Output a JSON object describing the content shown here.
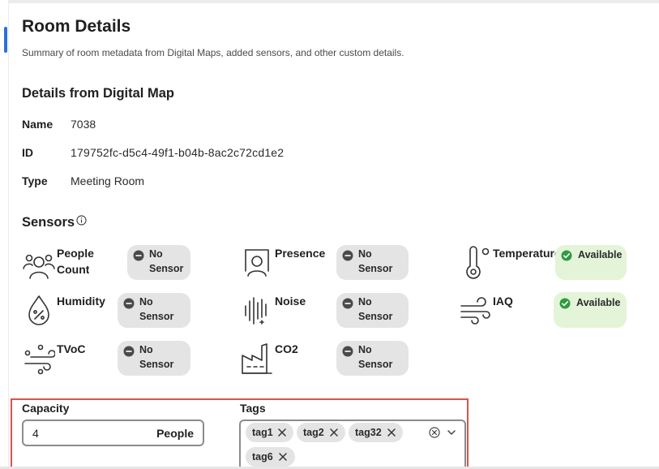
{
  "header": {
    "title": "Room Details",
    "subtitle": "Summary of room metadata from Digital Maps, added sensors, and other custom details."
  },
  "digital_map": {
    "heading": "Details from Digital Map",
    "fields": [
      {
        "label": "Name",
        "value": "7038"
      },
      {
        "label": "ID",
        "value": "179752fc-d5c4-49f1-b04b-8ac2c72cd1e2"
      },
      {
        "label": "Type",
        "value": "Meeting Room"
      }
    ]
  },
  "sensors": {
    "heading": "Sensors",
    "info_icon": "info-icon",
    "items": [
      {
        "name": "People Count",
        "name_line1": "People",
        "name_line2": "Count",
        "icon": "people-icon",
        "status_line1": "No",
        "status_line2": "Sensor",
        "status": "no-sensor"
      },
      {
        "name": "Presence",
        "icon": "presence-icon",
        "status_line1": "No",
        "status_line2": "Sensor",
        "status": "no-sensor"
      },
      {
        "name": "Temperature",
        "icon": "thermometer-icon",
        "status_line1": "Available",
        "status": "available"
      },
      {
        "name": "Humidity",
        "icon": "humidity-icon",
        "status_line1": "No",
        "status_line2": "Sensor",
        "status": "no-sensor"
      },
      {
        "name": "Noise",
        "icon": "noise-icon",
        "status_line1": "No",
        "status_line2": "Sensor",
        "status": "no-sensor"
      },
      {
        "name": "IAQ",
        "icon": "wind-icon",
        "status_line1": "Available",
        "status": "available"
      },
      {
        "name": "TVoC",
        "icon": "tvoc-icon",
        "status_line1": "No",
        "status_line2": "Sensor",
        "status": "no-sensor"
      },
      {
        "name": "CO2",
        "icon": "factory-icon",
        "status_line1": "No",
        "status_line2": "Sensor",
        "status": "no-sensor"
      }
    ]
  },
  "custom": {
    "capacity_label": "Capacity",
    "capacity_value": "4",
    "capacity_unit": "People",
    "tags_label": "Tags",
    "tags": [
      "tag1",
      "tag2",
      "tag32",
      "tag6"
    ]
  },
  "colors": {
    "accent": "#2f6fd6",
    "available_bg": "#e3f4d9",
    "available_icon": "#2e9c3e",
    "no_sensor_bg": "#e4e4e4",
    "highlight_border": "#d9534f"
  }
}
